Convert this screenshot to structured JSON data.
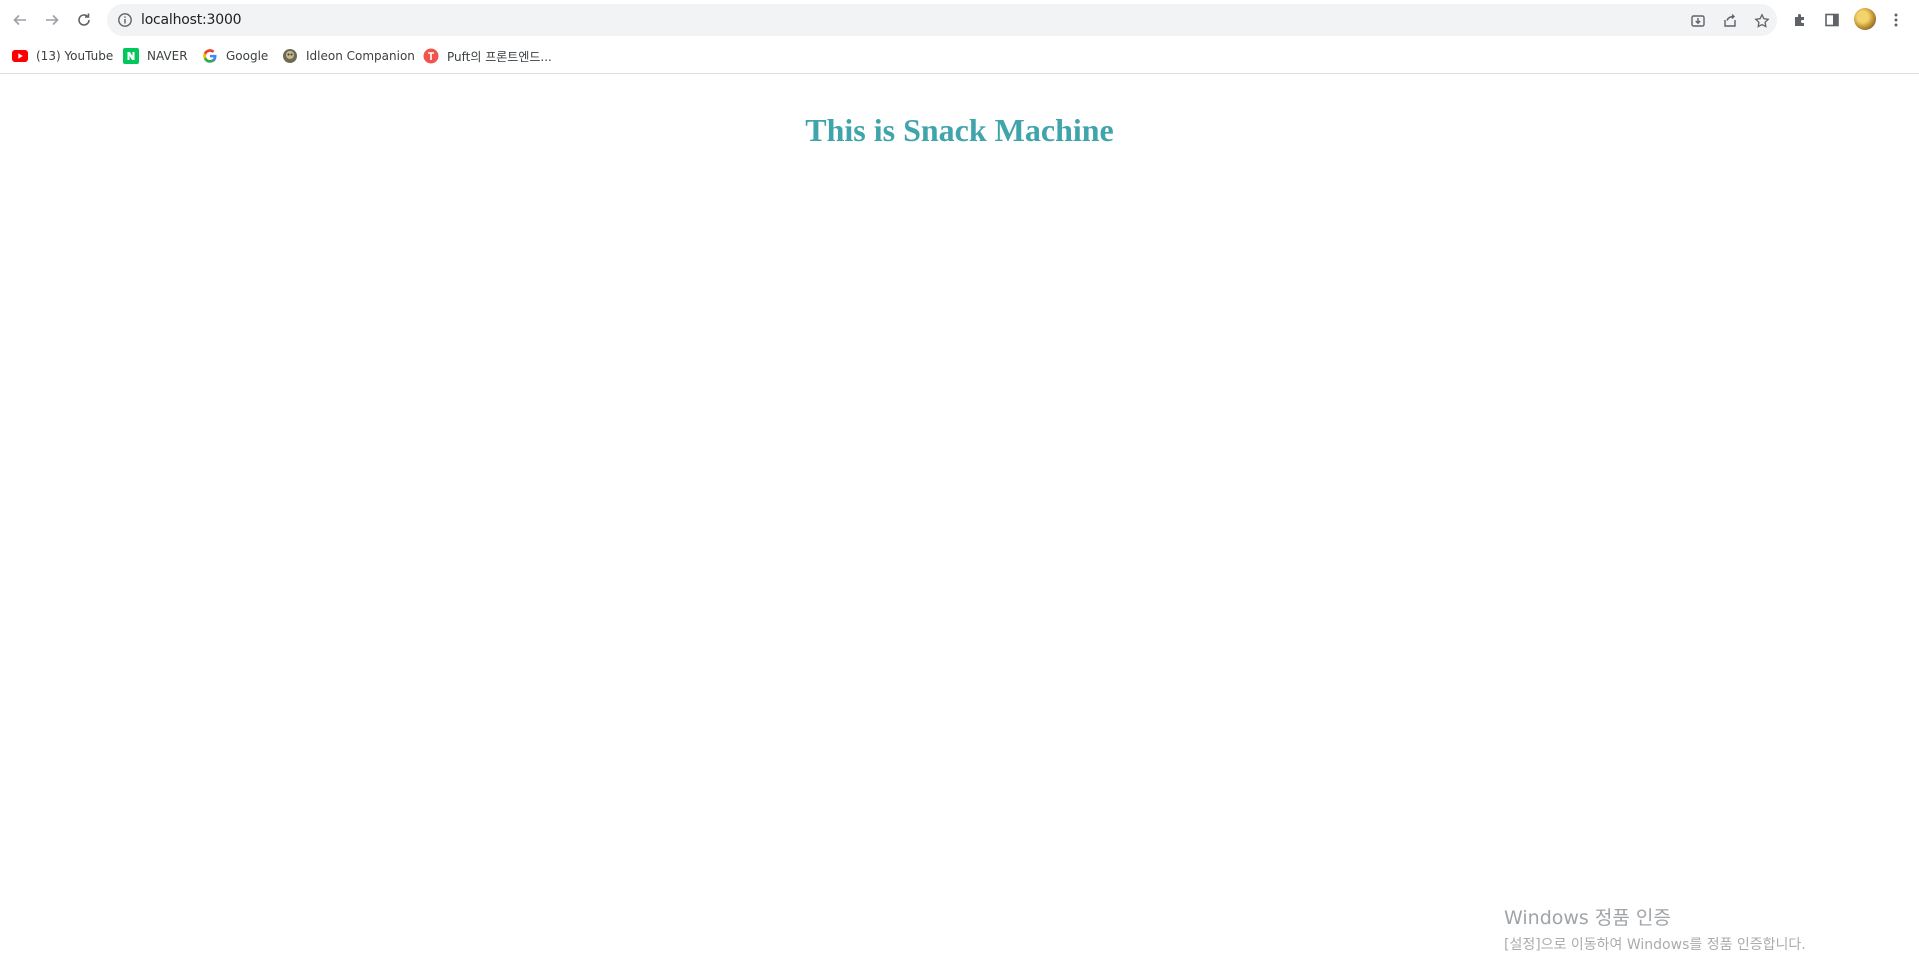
{
  "browser": {
    "url": "localhost:3000",
    "bookmarks": [
      {
        "label": "(13) YouTube",
        "icon": "youtube-icon"
      },
      {
        "label": "NAVER",
        "icon": "naver-icon"
      },
      {
        "label": "Google",
        "icon": "google-icon"
      },
      {
        "label": "Idleon Companion",
        "icon": "idleon-icon"
      },
      {
        "label": "Puft의 프론트엔드...",
        "icon": "puft-icon"
      }
    ]
  },
  "page": {
    "title": "This is Snack Machine",
    "title_color": "#3fa4ab"
  },
  "watermark": {
    "line1": "Windows 정품 인증",
    "line2": "[설정]으로 이동하여 Windows를 정품 인증합니다."
  }
}
